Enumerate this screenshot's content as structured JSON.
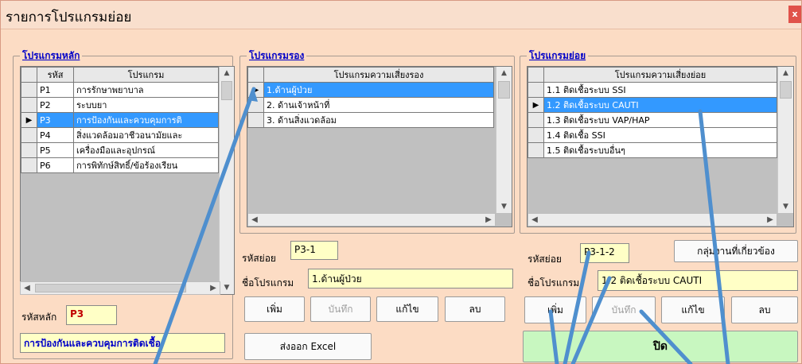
{
  "window": {
    "title": "รายการโปรแกรมย่อย",
    "close_glyph": "x"
  },
  "groups": {
    "main": "โปรแกรมหลัก",
    "secondary": "โปรแกรมรอง",
    "sub": "โปรแกรมย่อย"
  },
  "main_grid": {
    "headers": [
      "รหัส",
      "โปรแกรม"
    ],
    "rows": [
      {
        "code": "P1",
        "name": "การรักษาพยาบาล"
      },
      {
        "code": "P2",
        "name": "ระบบยา"
      },
      {
        "code": "P3",
        "name": "การป้องกันและควบคุมการติ"
      },
      {
        "code": "P4",
        "name": "สิ่งแวดล้อมอาชีวอนามัยและ"
      },
      {
        "code": "P5",
        "name": "เครื่องมือและอุปกรณ์"
      },
      {
        "code": "P6",
        "name": "การพิทักษ์สิทธิ์/ข้อร้องเรียน"
      }
    ],
    "selected_index": 2
  },
  "main_code": {
    "label": "รหัสหลัก",
    "value": "P3"
  },
  "main_name": {
    "value": "การป้องกันและควบคุมการติดเชื้อ"
  },
  "secondary_grid": {
    "header": "โปรแกรมความเสี่ยงรอง",
    "rows": [
      "1.ด้านผู้ป่วย",
      "2. ด้านเจ้าหน้าที่",
      "3. ด้านสิ่งแวดล้อม"
    ],
    "selected_index": 0
  },
  "secondary_form": {
    "code_label": "รหัสย่อย",
    "code_value": "P3-1",
    "name_label": "ชื่อโปรแกรม",
    "name_value": "1.ด้านผู้ป่วย"
  },
  "secondary_buttons": {
    "add": "เพิ่ม",
    "save": "บันทึก",
    "edit": "แก้ไข",
    "delete": "ลบ",
    "export": "ส่งออก Excel"
  },
  "sub_grid": {
    "header": "โปรแกรมความเสี่ยงย่อย",
    "rows": [
      "1.1 ติดเชื้อระบบ SSI",
      "1.2 ติดเชื้อระบบ CAUTI",
      "1.3 ติดเชื้อระบบ VAP/HAP",
      "1.4 ติดเชื้อ SSI",
      "1.5 ติดเชื้อระบบอื่นๆ"
    ],
    "selected_index": 1
  },
  "sub_form": {
    "code_label": "รหัสย่อย",
    "code_value": "P3-1-2",
    "name_label": "ชื่อโปรแกรม",
    "name_value": "1.2 ติดเชื้อระบบ CAUTI",
    "related_button": "กลุ่มงานที่เกี่ยวข้อง"
  },
  "sub_buttons": {
    "add": "เพิ่ม",
    "save": "บันทึก",
    "edit": "แก้ไข",
    "delete": "ลบ",
    "close": "ปิด"
  },
  "colors": {
    "window_bg": "#fcdcc4",
    "selection": "#3399ff",
    "field_bg": "#ffffc6",
    "legend": "#0000c8",
    "close_button": "#c8f7c0",
    "annotation_arrow": "#4f8fce"
  }
}
